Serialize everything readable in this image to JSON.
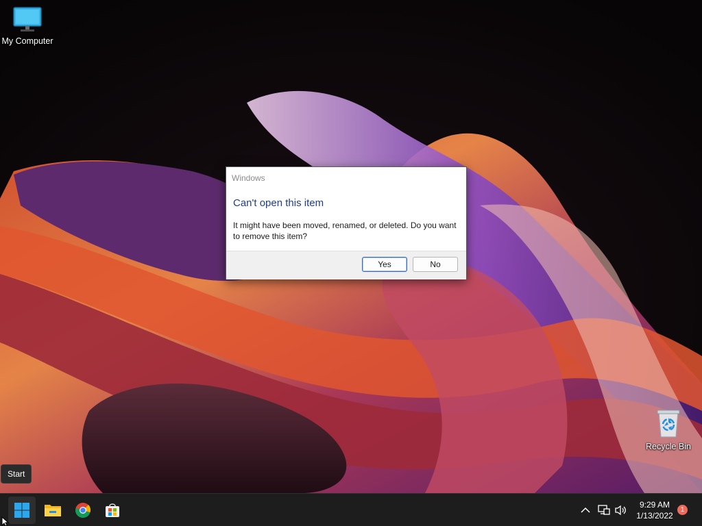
{
  "desktop": {
    "icons": [
      {
        "label": "My Computer",
        "icon": "monitor-icon"
      },
      {
        "label": "Recycle Bin",
        "icon": "recycle-bin-icon"
      }
    ]
  },
  "tooltip": {
    "text": "Start"
  },
  "dialog": {
    "title": "Windows",
    "heading": "Can't open this item",
    "message": "It might have been moved, renamed, or deleted. Do you want to remove this item?",
    "buttons": {
      "yes": "Yes",
      "no": "No"
    },
    "heading_color": "#1e3d8f"
  },
  "taskbar": {
    "apps": [
      {
        "name": "Start",
        "icon": "windows-logo-icon"
      },
      {
        "name": "File Explorer",
        "icon": "folder-icon"
      },
      {
        "name": "Google Chrome",
        "icon": "chrome-icon"
      },
      {
        "name": "Microsoft Store",
        "icon": "store-icon"
      }
    ],
    "tray": {
      "time": "9:29 AM",
      "date": "1/13/2022",
      "notification_count": "1",
      "icons": [
        "chevron-up-icon",
        "network-icon",
        "volume-icon"
      ]
    }
  }
}
